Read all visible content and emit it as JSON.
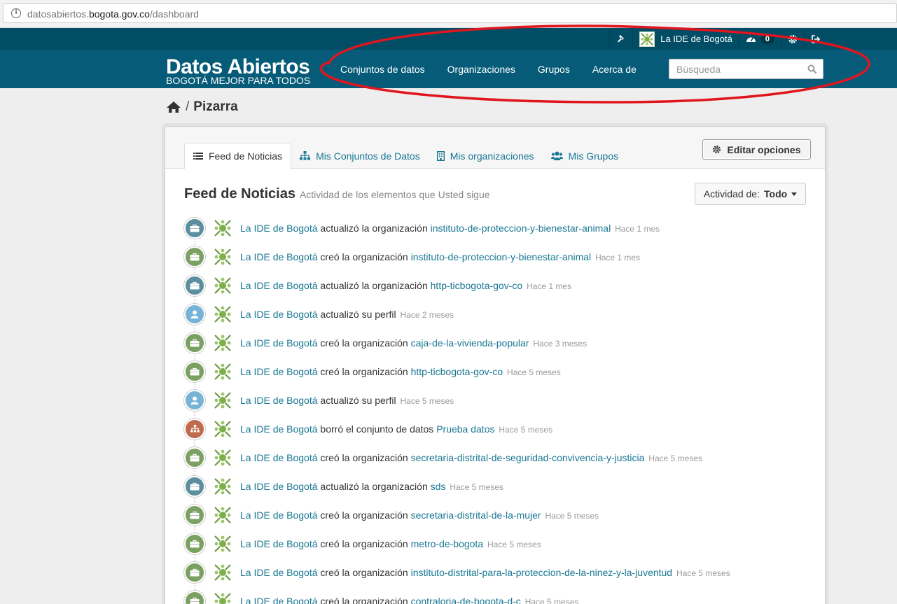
{
  "browser": {
    "url_prefix": "datosabiertos.",
    "url_domain": "bogota.gov.co",
    "url_path": "/dashboard"
  },
  "account": {
    "user_name": "La IDE de Bogotá",
    "notification_count": "0",
    "icons": [
      "gavel-icon",
      "avatar",
      "dashboard-icon",
      "gear-icon",
      "sign-out-icon"
    ]
  },
  "header": {
    "logo_title": "Datos Abiertos",
    "logo_subtitle": "BOGOTÁ MEJOR PARA TODOS",
    "nav": [
      "Conjuntos de datos",
      "Organizaciones",
      "Grupos",
      "Acerca de"
    ],
    "search_placeholder": "Búsqueda"
  },
  "breadcrumb": {
    "current": "Pizarra"
  },
  "tabs": [
    {
      "label": "Feed de Noticias",
      "icon": "list-icon",
      "active": true
    },
    {
      "label": "Mis Conjuntos de Datos",
      "icon": "sitemap-icon",
      "active": false
    },
    {
      "label": "Mis organizaciones",
      "icon": "building-icon",
      "active": false
    },
    {
      "label": "Mis Grupos",
      "icon": "group-icon",
      "active": false
    }
  ],
  "edit_button": "Editar opciones",
  "feed": {
    "title": "Feed de Noticias",
    "subtitle": "Actividad de los elementos que Usted sigue",
    "filter_label": "Actividad de:",
    "filter_value": "Todo"
  },
  "colors": {
    "update": "#5b8fa0",
    "create": "#7aa162",
    "user": "#76b3d6",
    "delete": "#c06b4e",
    "link": "#187794",
    "header": "#065c78",
    "account_bar": "#004d65"
  },
  "activities": [
    {
      "type": "update",
      "icon": "briefcase-icon",
      "user": "La IDE de Bogotá",
      "action": "actualizó la organización",
      "object": "instituto-de-proteccion-y-bienestar-animal",
      "time": "Hace 1 mes"
    },
    {
      "type": "create",
      "icon": "briefcase-icon",
      "user": "La IDE de Bogotá",
      "action": "creó la organización",
      "object": "instituto-de-proteccion-y-bienestar-animal",
      "time": "Hace 1 mes"
    },
    {
      "type": "update",
      "icon": "briefcase-icon",
      "user": "La IDE de Bogotá",
      "action": "actualizó la organización",
      "object": "http-ticbogota-gov-co",
      "time": "Hace 1 mes"
    },
    {
      "type": "user",
      "icon": "user-icon",
      "user": "La IDE de Bogotá",
      "action": "actualizó su perfil",
      "object": "",
      "time": "Hace 2 meses"
    },
    {
      "type": "create",
      "icon": "briefcase-icon",
      "user": "La IDE de Bogotá",
      "action": "creó la organización",
      "object": "caja-de-la-vivienda-popular",
      "time": "Hace 3 meses"
    },
    {
      "type": "create",
      "icon": "briefcase-icon",
      "user": "La IDE de Bogotá",
      "action": "creó la organización",
      "object": "http-ticbogota-gov-co",
      "time": "Hace 5 meses"
    },
    {
      "type": "user",
      "icon": "user-icon",
      "user": "La IDE de Bogotá",
      "action": "actualizó su perfil",
      "object": "",
      "time": "Hace 5 meses"
    },
    {
      "type": "delete",
      "icon": "sitemap-icon",
      "user": "La IDE de Bogotá",
      "action": "borró el conjunto de datos",
      "object": "Prueba datos",
      "time": "Hace 5 meses"
    },
    {
      "type": "create",
      "icon": "briefcase-icon",
      "user": "La IDE de Bogotá",
      "action": "creó la organización",
      "object": "secretaria-distrital-de-seguridad-convivencia-y-justicia",
      "time": "Hace 5 meses"
    },
    {
      "type": "update",
      "icon": "briefcase-icon",
      "user": "La IDE de Bogotá",
      "action": "actualizó la organización",
      "object": "sds",
      "time": "Hace 5 meses"
    },
    {
      "type": "create",
      "icon": "briefcase-icon",
      "user": "La IDE de Bogotá",
      "action": "creó la organización",
      "object": "secretaria-distrital-de-la-mujer",
      "time": "Hace 5 meses"
    },
    {
      "type": "create",
      "icon": "briefcase-icon",
      "user": "La IDE de Bogotá",
      "action": "creó la organización",
      "object": "metro-de-bogota",
      "time": "Hace 5 meses"
    },
    {
      "type": "create",
      "icon": "briefcase-icon",
      "user": "La IDE de Bogotá",
      "action": "creó la organización",
      "object": "instituto-distrital-para-la-proteccion-de-la-ninez-y-la-juventud",
      "time": "Hace 5 meses"
    },
    {
      "type": "create",
      "icon": "briefcase-icon",
      "user": "La IDE de Bogotá",
      "action": "creó la organización",
      "object": "contraloria-de-bogota-d-c",
      "time": "Hace 5 meses"
    }
  ]
}
